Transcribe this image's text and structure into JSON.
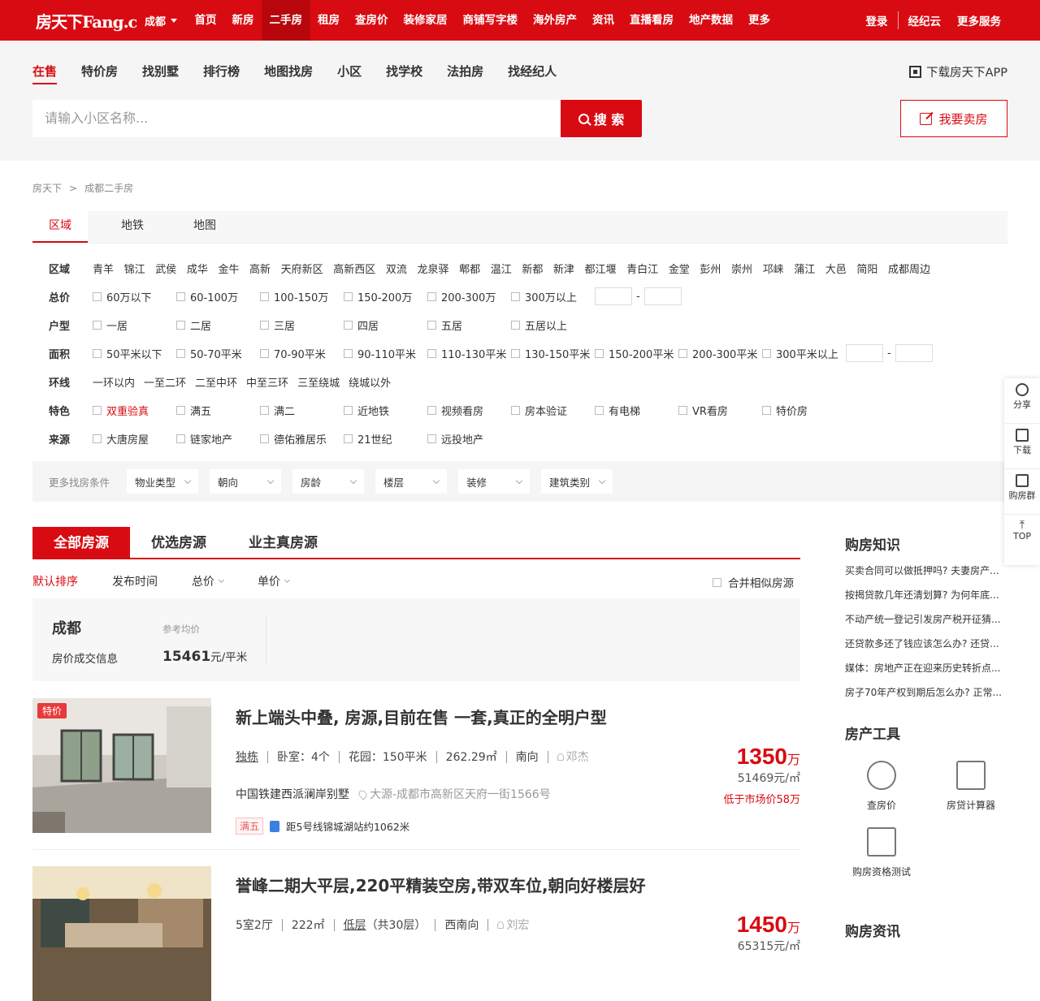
{
  "topnav": {
    "logo": "房天下Fang.com",
    "city": "成都",
    "items": [
      "首页",
      "新房",
      "二手房",
      "租房",
      "查房价",
      "装修家居",
      "商铺写字楼",
      "海外房产",
      "资讯",
      "直播看房",
      "地产数据",
      "更多"
    ],
    "active_index": 2,
    "right": [
      "登录",
      "经纪云",
      "更多服务"
    ]
  },
  "subnav": {
    "items": [
      "在售",
      "特价房",
      "找别墅",
      "排行榜",
      "地图找房",
      "小区",
      "找学校",
      "法拍房",
      "找经纪人"
    ],
    "app_download": "下载房天下APP"
  },
  "search": {
    "placeholder": "请输入小区名称...",
    "button": "搜 索",
    "sell_button": "我要卖房"
  },
  "breadcrumb": [
    "房天下",
    "成都二手房"
  ],
  "filter": {
    "tabs": [
      "区域",
      "地铁",
      "地图"
    ],
    "region_label": "区域",
    "regions": [
      "青羊",
      "锦江",
      "武侯",
      "成华",
      "金牛",
      "高新",
      "天府新区",
      "高新西区",
      "双流",
      "龙泉驿",
      "郫都",
      "温江",
      "新都",
      "新津",
      "都江堰",
      "青白江",
      "金堂",
      "彭州",
      "崇州",
      "邛崃",
      "蒲江",
      "大邑",
      "简阳",
      "成都周边"
    ],
    "price_label": "总价",
    "prices": [
      "60万以下",
      "60-100万",
      "100-150万",
      "150-200万",
      "200-300万",
      "300万以上"
    ],
    "layout_label": "户型",
    "layouts": [
      "一居",
      "二居",
      "三居",
      "四居",
      "五居",
      "五居以上"
    ],
    "area_label": "面积",
    "areas": [
      "50平米以下",
      "50-70平米",
      "70-90平米",
      "90-110平米",
      "110-130平米",
      "130-150平米",
      "150-200平米",
      "200-300平米",
      "300平米以上"
    ],
    "ring_label": "环线",
    "rings": [
      "一环以内",
      "一至二环",
      "二至中环",
      "中至三环",
      "三至绕城",
      "绕城以外"
    ],
    "feature_label": "特色",
    "features": [
      "双重验真",
      "满五",
      "满二",
      "近地铁",
      "视频看房",
      "房本验证",
      "有电梯",
      "VR看房",
      "特价房"
    ],
    "source_label": "来源",
    "sources": [
      "大唐房屋",
      "链家地产",
      "德佑雅居乐",
      "21世纪",
      "远投地产"
    ],
    "more_label": "更多找房条件",
    "dropdowns": [
      "物业类型",
      "朝向",
      "房龄",
      "楼层",
      "装修",
      "建筑类别"
    ],
    "range_dash": "-"
  },
  "list": {
    "tabs": [
      "全部房源",
      "优选房源",
      "业主真房源"
    ],
    "sorts": [
      "默认排序",
      "发布时间",
      "总价",
      "单价"
    ],
    "merge": "合并相似房源"
  },
  "price_info": {
    "city": "成都",
    "sub": "房价成交信息",
    "ref_label": "参考均价",
    "value": "15461",
    "unit": "元/平米"
  },
  "listings": [
    {
      "tag": "特价",
      "title": "新上端头中叠, 房源,目前在售 一套,真正的全明户型",
      "attrs": [
        "独栋",
        "卧室：4个",
        "花园：150平米",
        "262.29㎡",
        "南向"
      ],
      "agent": "邓杰",
      "community": "中国铁建西派澜岸别墅",
      "address": "大源-成都市高新区天府一街1566号",
      "tags": [
        "满五"
      ],
      "metro": "距5号线锦城湖站约1062米",
      "price": "1350",
      "price_unit": "万",
      "unit_price": "51469元/㎡",
      "low": "低于市场价58万"
    },
    {
      "tag": "",
      "title": "誉峰二期大平层,220平精装空房,带双车位,朝向好楼层好",
      "attrs": [
        "5室2厅",
        "222㎡",
        "低层",
        "（共30层）",
        "西南向"
      ],
      "agent": "刘宏",
      "price": "1450",
      "price_unit": "万",
      "unit_price": "65315元/㎡"
    }
  ],
  "sidebar": {
    "knowledge_title": "购房知识",
    "articles": [
      "买卖合同可以做抵押吗? 夫妻房产...",
      "按揭贷款几年还清划算? 为何年底...",
      "不动产统一登记引发房产税开征猜...",
      "还贷款多还了钱应该怎么办? 还贷...",
      "媒体：房地产正在迎来历史转折点...",
      "房子70年产权到期后怎么办? 正常..."
    ],
    "tools_title": "房产工具",
    "tools": [
      "查房价",
      "房贷计算器",
      "购房资格测试"
    ],
    "news_title": "购房资讯"
  },
  "floatbar": [
    "分享",
    "下载",
    "购房群",
    "TOP"
  ],
  "colors": {
    "brand": "#d90b12",
    "tag_bg": "#e83a3a",
    "metro": "#3d7fe0"
  }
}
